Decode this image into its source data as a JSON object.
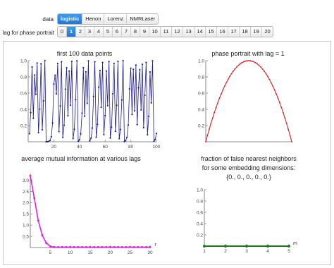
{
  "controls": {
    "data_label": "data",
    "data_options": [
      "logistic",
      "Henon",
      "Lorenz",
      "NMRLaser"
    ],
    "data_selected": "logistic",
    "lag_label": "lag for phase portrait",
    "lag_options": [
      "0",
      "1",
      "2",
      "3",
      "4",
      "5",
      "6",
      "7",
      "8",
      "9",
      "10",
      "11",
      "12",
      "13",
      "14",
      "15",
      "16",
      "17",
      "18",
      "19",
      "20"
    ],
    "lag_selected": "1"
  },
  "titles": {
    "series": "first 100 data points",
    "phase": "phase portrait with lag = 1",
    "mutual": "average mutual information at various lags",
    "fnn_line1": "fraction of false nearest neighbors",
    "fnn_line2": "for some embedding dimensions:",
    "fnn_line3": "{0., 0., 0., 0., 0.}"
  },
  "colors": {
    "series_line": "#1d1d8c",
    "phase_curve": "#d41414",
    "mutual_curve": "#e020e0",
    "fnn_curve": "#1a7a1a"
  },
  "chart_data": [
    {
      "type": "line",
      "title": "first 100 data points",
      "x": "1..100",
      "xticks": [
        20,
        40,
        60,
        80,
        100
      ],
      "yticks": [
        0.2,
        0.4,
        0.6,
        0.8,
        1.0
      ],
      "ylim": [
        0,
        1
      ],
      "xlim": [
        0,
        100
      ],
      "generator": "logistic map r=4",
      "values_first": [
        0.1,
        0.36,
        0.9216,
        0.289,
        0.822,
        0.585,
        0.971,
        0.113,
        0.402,
        0.962
      ]
    },
    {
      "type": "line",
      "title": "phase portrait with lag = 1",
      "x": [
        0,
        0.1,
        0.2,
        0.3,
        0.4,
        0.5,
        0.6,
        0.7,
        0.8,
        0.9,
        1.0
      ],
      "y": [
        0,
        0.36,
        0.64,
        0.84,
        0.96,
        1.0,
        0.96,
        0.84,
        0.64,
        0.36,
        0
      ],
      "xlim": [
        0,
        1
      ],
      "ylim": [
        0,
        1
      ],
      "yticks": [
        0.2,
        0.4,
        0.6,
        0.8,
        1.0
      ]
    },
    {
      "type": "line",
      "title": "average mutual information at various lags",
      "x": [
        0,
        1,
        2,
        3,
        4,
        5,
        6,
        7,
        8,
        9,
        10,
        11,
        12,
        13,
        14,
        15,
        16,
        17,
        18,
        19,
        20,
        21,
        22,
        23,
        24,
        25,
        26,
        27,
        28,
        29,
        30
      ],
      "y": [
        3.2,
        2.2,
        1.2,
        0.55,
        0.2,
        0.05,
        0.02,
        0.02,
        0.02,
        0.02,
        0.02,
        0.02,
        0.02,
        0.02,
        0.02,
        0.02,
        0.02,
        0.02,
        0.02,
        0.02,
        0.02,
        0.02,
        0.02,
        0.02,
        0.02,
        0.02,
        0.02,
        0.02,
        0.02,
        0.02,
        0.02
      ],
      "xticks": [
        5,
        10,
        15,
        20,
        25,
        30
      ],
      "yticks": [
        0.5,
        1.0,
        1.5,
        2.0,
        2.5,
        3.0
      ],
      "xlabel": "τ",
      "ylim": [
        0,
        3.3
      ]
    },
    {
      "type": "line",
      "title": "fraction of false nearest neighbors",
      "x": [
        1,
        2,
        3,
        4,
        5
      ],
      "y": [
        0,
        0,
        0,
        0,
        0
      ],
      "xticks": [
        1,
        2,
        3,
        4,
        5
      ],
      "yticks": [
        0.2,
        0.4,
        0.6,
        0.8,
        1.0
      ],
      "xlabel": "m",
      "ylim": [
        0,
        1
      ]
    }
  ]
}
